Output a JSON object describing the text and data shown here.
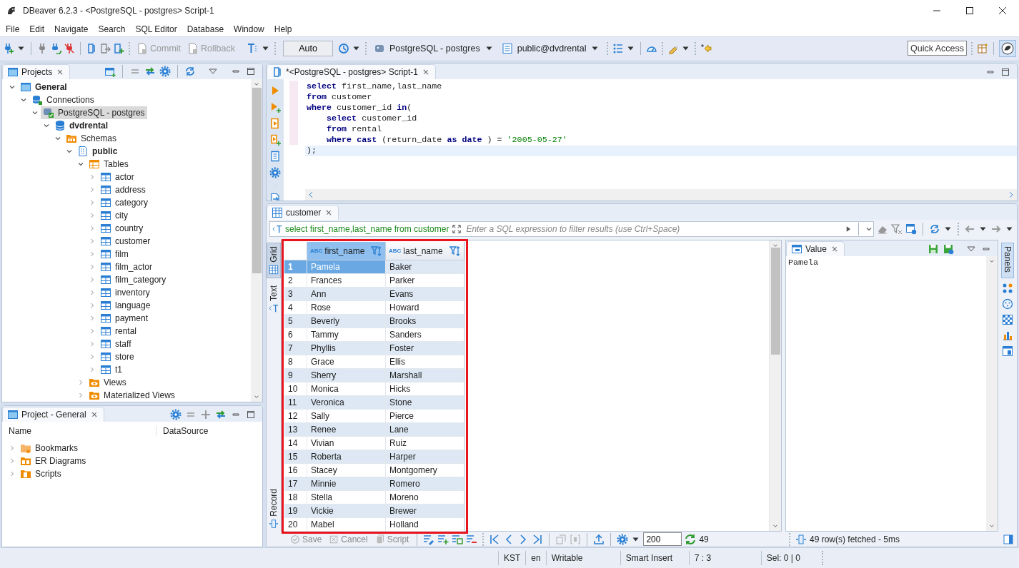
{
  "window": {
    "title": "DBeaver 6.2.3 - <PostgreSQL - postgres> Script-1"
  },
  "menu": [
    "File",
    "Edit",
    "Navigate",
    "Search",
    "SQL Editor",
    "Database",
    "Window",
    "Help"
  ],
  "toolbar": {
    "commit": {
      "label": "Commit",
      "disabled": true
    },
    "rollback": {
      "label": "Rollback",
      "disabled": true
    },
    "transaction_mode": "Auto",
    "connection": "PostgreSQL - postgres",
    "schema": "public@dvdrental",
    "quick_access": "Quick Access"
  },
  "projects": {
    "title": "Projects",
    "tree": [
      {
        "label": "General",
        "kind": "project",
        "expanded": true,
        "selected": false,
        "children": [
          {
            "label": "Connections",
            "kind": "connections",
            "expanded": true,
            "selected": false,
            "children": [
              {
                "label": "PostgreSQL - postgres",
                "kind": "connection",
                "expanded": true,
                "selected": true,
                "children": [
                  {
                    "label": "dvdrental",
                    "kind": "database",
                    "expanded": true,
                    "selected": false,
                    "children": [
                      {
                        "label": "Schemas",
                        "kind": "schemas",
                        "expanded": true,
                        "selected": false,
                        "children": [
                          {
                            "label": "public",
                            "kind": "schema",
                            "expanded": true,
                            "selected": false,
                            "children": [
                              {
                                "label": "Tables",
                                "kind": "tables",
                                "expanded": true,
                                "selected": false,
                                "children": [
                                  {
                                    "label": "actor",
                                    "kind": "table",
                                    "expanded": false,
                                    "selected": false
                                  },
                                  {
                                    "label": "address",
                                    "kind": "table",
                                    "expanded": false,
                                    "selected": false
                                  },
                                  {
                                    "label": "category",
                                    "kind": "table",
                                    "expanded": false,
                                    "selected": false
                                  },
                                  {
                                    "label": "city",
                                    "kind": "table",
                                    "expanded": false,
                                    "selected": false
                                  },
                                  {
                                    "label": "country",
                                    "kind": "table",
                                    "expanded": false,
                                    "selected": false
                                  },
                                  {
                                    "label": "customer",
                                    "kind": "table",
                                    "expanded": false,
                                    "selected": false
                                  },
                                  {
                                    "label": "film",
                                    "kind": "table",
                                    "expanded": false,
                                    "selected": false
                                  },
                                  {
                                    "label": "film_actor",
                                    "kind": "table",
                                    "expanded": false,
                                    "selected": false
                                  },
                                  {
                                    "label": "film_category",
                                    "kind": "table",
                                    "expanded": false,
                                    "selected": false
                                  },
                                  {
                                    "label": "inventory",
                                    "kind": "table",
                                    "expanded": false,
                                    "selected": false
                                  },
                                  {
                                    "label": "language",
                                    "kind": "table",
                                    "expanded": false,
                                    "selected": false
                                  },
                                  {
                                    "label": "payment",
                                    "kind": "table",
                                    "expanded": false,
                                    "selected": false
                                  },
                                  {
                                    "label": "rental",
                                    "kind": "table",
                                    "expanded": false,
                                    "selected": false
                                  },
                                  {
                                    "label": "staff",
                                    "kind": "table",
                                    "expanded": false,
                                    "selected": false
                                  },
                                  {
                                    "label": "store",
                                    "kind": "table",
                                    "expanded": false,
                                    "selected": false
                                  },
                                  {
                                    "label": "t1",
                                    "kind": "table",
                                    "expanded": false,
                                    "selected": false
                                  }
                                ]
                              },
                              {
                                "label": "Views",
                                "kind": "views",
                                "expanded": false,
                                "selected": false
                              },
                              {
                                "label": "Materialized Views",
                                "kind": "views",
                                "expanded": false,
                                "selected": false
                              }
                            ]
                          }
                        ]
                      }
                    ]
                  }
                ]
              }
            ]
          }
        ]
      }
    ]
  },
  "project_general": {
    "title": "Project - General",
    "columns": [
      "Name",
      "DataSource"
    ],
    "items": [
      {
        "label": "Bookmarks",
        "kind": "bookmarks",
        "expanded": false
      },
      {
        "label": "ER Diagrams",
        "kind": "diagrams",
        "expanded": false
      },
      {
        "label": "Scripts",
        "kind": "scripts",
        "expanded": false
      }
    ]
  },
  "editor": {
    "tab": "*<PostgreSQL - postgres> Script-1",
    "lines": [
      {
        "current": false,
        "tokens": [
          {
            "kind": "keyword",
            "text": "select"
          },
          {
            "kind": "plain",
            "text": " first_name,last_name"
          }
        ]
      },
      {
        "current": false,
        "tokens": [
          {
            "kind": "keyword",
            "text": "from"
          },
          {
            "kind": "plain",
            "text": " customer"
          }
        ]
      },
      {
        "current": false,
        "tokens": [
          {
            "kind": "keyword",
            "text": "where"
          },
          {
            "kind": "plain",
            "text": " customer_id "
          },
          {
            "kind": "keyword",
            "text": "in"
          },
          {
            "kind": "plain",
            "text": "("
          }
        ]
      },
      {
        "current": false,
        "tokens": [
          {
            "kind": "keyword",
            "text": "    select"
          },
          {
            "kind": "plain",
            "text": " customer_id"
          }
        ]
      },
      {
        "current": false,
        "tokens": [
          {
            "kind": "keyword",
            "text": "    from"
          },
          {
            "kind": "plain",
            "text": " rental"
          }
        ]
      },
      {
        "current": false,
        "tokens": [
          {
            "kind": "keyword",
            "text": "    where cast"
          },
          {
            "kind": "plain",
            "text": " (return_date "
          },
          {
            "kind": "keyword",
            "text": "as date"
          },
          {
            "kind": "plain",
            "text": " ) = "
          },
          {
            "kind": "string",
            "text": "'2005-05-27'"
          }
        ]
      },
      {
        "current": true,
        "tokens": [
          {
            "kind": "plain",
            "text": ");"
          }
        ]
      }
    ]
  },
  "results": {
    "tab": "customer",
    "query": "select first_name,last_name from customer",
    "filter_placeholder": "Enter a SQL expression to filter results (use Ctrl+Space)",
    "view_tabs": [
      {
        "label": "Grid",
        "selected": true
      },
      {
        "label": "Text",
        "selected": false
      },
      {
        "label": "Record",
        "selected": false
      }
    ],
    "columns": [
      {
        "name": "first_name",
        "type": "ABC",
        "selected": true
      },
      {
        "name": "last_name",
        "type": "ABC",
        "selected": false
      }
    ],
    "rows": [
      {
        "number": "1",
        "cells": [
          "Pamela",
          "Baker"
        ],
        "selected": true
      },
      {
        "number": "2",
        "cells": [
          "Frances",
          "Parker"
        ],
        "selected": false
      },
      {
        "number": "3",
        "cells": [
          "Ann",
          "Evans"
        ],
        "selected": false
      },
      {
        "number": "4",
        "cells": [
          "Rose",
          "Howard"
        ],
        "selected": false
      },
      {
        "number": "5",
        "cells": [
          "Beverly",
          "Brooks"
        ],
        "selected": false
      },
      {
        "number": "6",
        "cells": [
          "Tammy",
          "Sanders"
        ],
        "selected": false
      },
      {
        "number": "7",
        "cells": [
          "Phyllis",
          "Foster"
        ],
        "selected": false
      },
      {
        "number": "8",
        "cells": [
          "Grace",
          "Ellis"
        ],
        "selected": false
      },
      {
        "number": "9",
        "cells": [
          "Sherry",
          "Marshall"
        ],
        "selected": false
      },
      {
        "number": "10",
        "cells": [
          "Monica",
          "Hicks"
        ],
        "selected": false
      },
      {
        "number": "11",
        "cells": [
          "Veronica",
          "Stone"
        ],
        "selected": false
      },
      {
        "number": "12",
        "cells": [
          "Sally",
          "Pierce"
        ],
        "selected": false
      },
      {
        "number": "13",
        "cells": [
          "Renee",
          "Lane"
        ],
        "selected": false
      },
      {
        "number": "14",
        "cells": [
          "Vivian",
          "Ruiz"
        ],
        "selected": false
      },
      {
        "number": "15",
        "cells": [
          "Roberta",
          "Harper"
        ],
        "selected": false
      },
      {
        "number": "16",
        "cells": [
          "Stacey",
          "Montgomery"
        ],
        "selected": false
      },
      {
        "number": "17",
        "cells": [
          "Minnie",
          "Romero"
        ],
        "selected": false
      },
      {
        "number": "18",
        "cells": [
          "Stella",
          "Moreno"
        ],
        "selected": false
      },
      {
        "number": "19",
        "cells": [
          "Vickie",
          "Brewer"
        ],
        "selected": false
      },
      {
        "number": "20",
        "cells": [
          "Mabel",
          "Holland"
        ],
        "selected": false
      }
    ],
    "highlighted": true,
    "value_panel": {
      "title": "Value",
      "content": "Pamela"
    },
    "panels_tab": "Panels",
    "actions": [
      {
        "label": "Save",
        "disabled": true
      },
      {
        "label": "Cancel",
        "disabled": true
      },
      {
        "label": "Script",
        "disabled": true
      }
    ],
    "fetch_size": "200",
    "row_count": "49",
    "fetch_status": "49 row(s) fetched - 5ms"
  },
  "status_bar": [
    "KST",
    "en",
    "Writable",
    "Smart Insert",
    "7 : 3",
    "Sel: 0 | 0"
  ]
}
